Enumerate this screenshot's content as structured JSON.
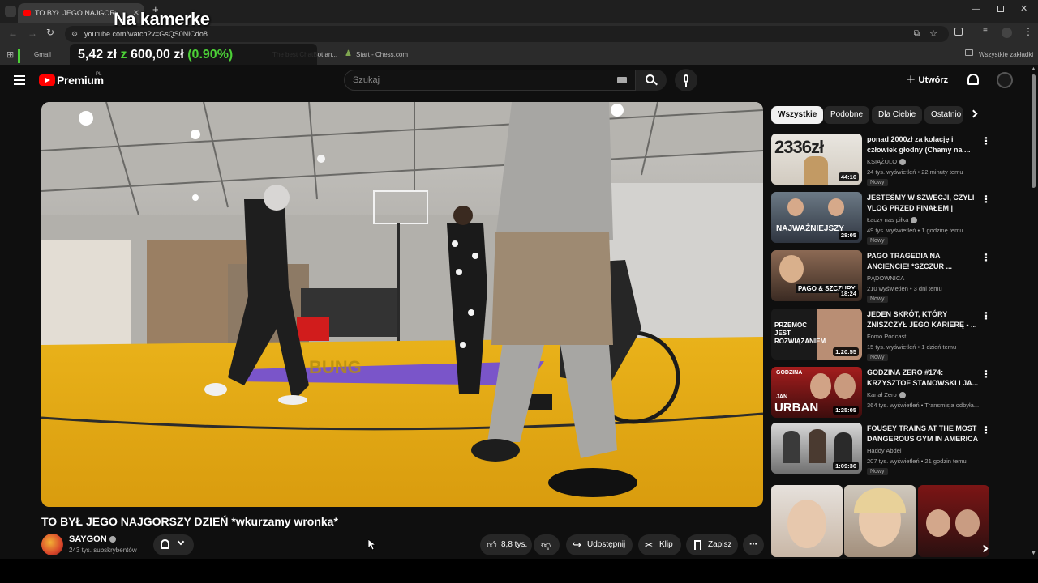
{
  "browser": {
    "tab_title": "TO BYŁ JEGO NAJGORSZY DZ",
    "url": "youtube.com/watch?v=GsQS0NiCdo8",
    "new_tab_icon": "plus-icon",
    "bookmarks": [
      "Gmail",
      "The best ChatBot an...",
      "Start - Chess.com"
    ],
    "bookmarks_folder": "Wszystkie zakładki",
    "window_controls": [
      "minimize-icon",
      "restore-icon",
      "close-icon"
    ]
  },
  "overlay": {
    "title": "Na kamerke",
    "price_current": "5,42 zł",
    "price_sep": "z",
    "price_target": "600,00 zł",
    "price_percent": "(0.90%)",
    "accent": "#4cd137"
  },
  "youtube": {
    "brand": "Premium",
    "country_code": "PL",
    "search_placeholder": "Szukaj",
    "create_label": "Utwórz",
    "brand_color": "#ff0000"
  },
  "video": {
    "title": "TO BYŁ JEGO NAJGORSZY DZIEŃ *wkurzamy wronka*",
    "channel": "SAYGON",
    "subscribers": "243 tys. subskrybentów",
    "likes": "8,8 tys.",
    "share_label": "Udostępnij",
    "clip_label": "Klip",
    "save_label": "Zapisz"
  },
  "sidebar": {
    "chips": [
      "Wszystkie",
      "Podobne",
      "Dla Ciebie",
      "Ostatnio"
    ],
    "recommendations": [
      {
        "title": "ponad 2000zł za kolację i człowiek głodny (Chamy na ...",
        "channel": "KSIĄŻULO",
        "verified": true,
        "meta": "24 tys. wyświetleń • 22 minuty temu",
        "badge": "Nowy",
        "duration": "44:16",
        "thumb_text": "2336zł"
      },
      {
        "title": "JESTEŚMY W SZWECJI, CZYLI VLOG PRZED FINAŁEM | Robot...",
        "channel": "Łączy nas piłka",
        "verified": true,
        "meta": "49 tys. wyświetleń • 1 godzinę temu",
        "badge": "Nowy",
        "duration": "28:05",
        "thumb_text": "NAJWAŻNIEJSZY"
      },
      {
        "title": "PAGO TRAGEDIA NA ANCIENCIE! *SZCZUR ...",
        "channel": "PĄDOWNICA",
        "verified": false,
        "meta": "210 wyświetleń • 3 dni temu",
        "badge": "Nowy",
        "duration": "18:24",
        "thumb_text": "PAGO & SZCZURY"
      },
      {
        "title": "JEDEN SKRÓT, KTÓRY ZNISZCZYŁ JEGO KARIERĘ - ...",
        "channel": "Fomo Podcast",
        "verified": false,
        "meta": "15 tys. wyświetleń • 1 dzień temu",
        "badge": "Nowy",
        "duration": "1:20:55",
        "thumb_text": "PRZEMOC JEST ROZWIĄZANIEM"
      },
      {
        "title": "GODZINA ZERO #174: KRZYSZTOF STANOWSKI I JA...",
        "channel": "Kanał Zero",
        "verified": true,
        "meta": "364 tys. wyświetleń • Transmisja odbyła...",
        "badge": "Nowy",
        "duration": "1:25:05",
        "thumb_text": "URBAN"
      },
      {
        "title": "FOUSEY TRAINS AT THE MOST DANGEROUS GYM IN AMERICA",
        "channel": "Haddy Abdel",
        "verified": false,
        "meta": "207 tys. wyświetleń • 21 godzin temu",
        "badge": "Nowy",
        "duration": "1:09:36",
        "thumb_text": ""
      }
    ],
    "thumb_heading_1": "GODZINA",
    "thumb_heading_2": "JAN"
  }
}
